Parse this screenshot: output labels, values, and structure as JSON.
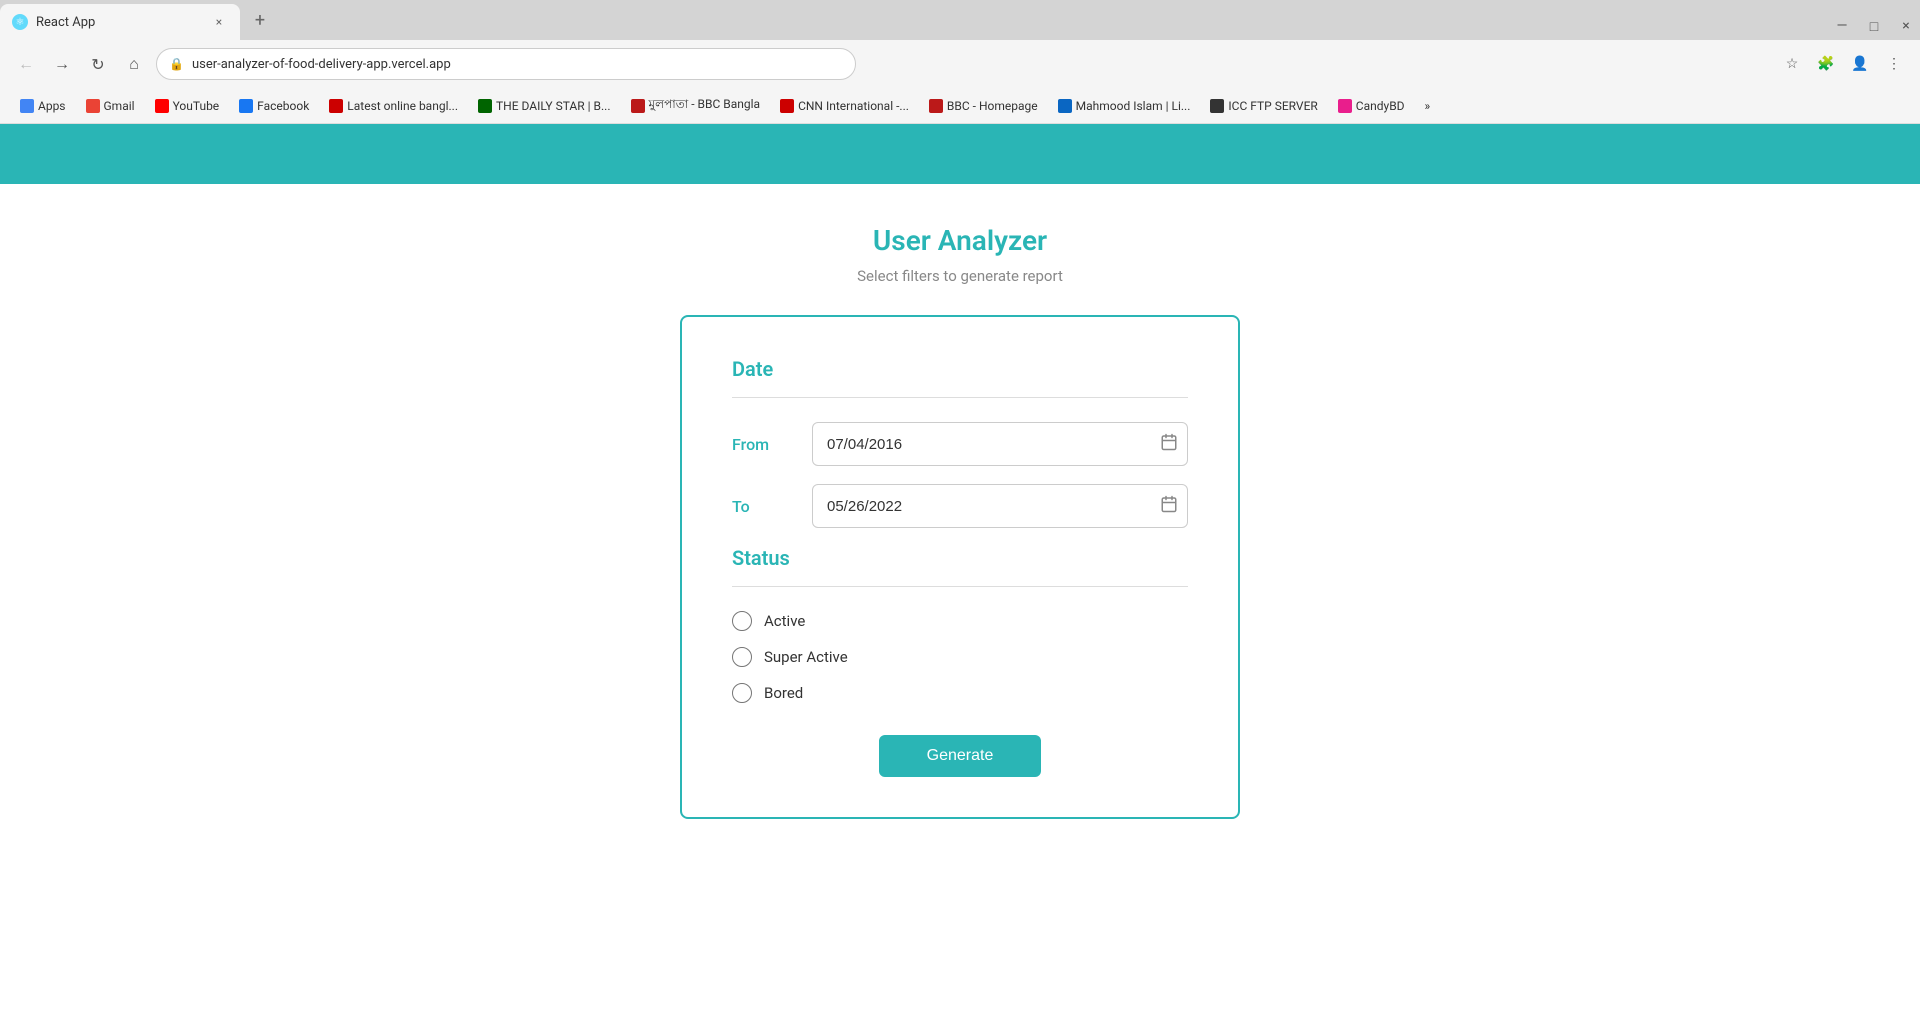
{
  "browser": {
    "tab_title": "React App",
    "tab_favicon": "⚛",
    "new_tab_icon": "+",
    "close_tab": "×",
    "address_url": "user-analyzer-of-food-delivery-app.vercel.app",
    "nav_back": "←",
    "nav_forward": "→",
    "nav_refresh": "↻",
    "nav_home": "⌂",
    "window_minimize": "—",
    "window_maximize": "□",
    "window_close": "×",
    "bookmarks": [
      {
        "label": "Apps",
        "favicon_color": "#4285f4"
      },
      {
        "label": "Gmail",
        "favicon_color": "#ea4335"
      },
      {
        "label": "YouTube",
        "favicon_color": "#ff0000"
      },
      {
        "label": "Facebook",
        "favicon_color": "#1877f2"
      },
      {
        "label": "Latest online bangl...",
        "favicon_color": "#cc0000"
      },
      {
        "label": "THE DAILY STAR | B...",
        "favicon_color": "#006400"
      },
      {
        "label": "মুলপাতা - BBC Bangla",
        "favicon_color": "#bb1919"
      },
      {
        "label": "CNN International -...",
        "favicon_color": "#cc0000"
      },
      {
        "label": "BBC - Homepage",
        "favicon_color": "#bb1919"
      },
      {
        "label": "Mahmood Islam | Li...",
        "favicon_color": "#0a66c2"
      },
      {
        "label": "ICC FTP SERVER",
        "favicon_color": "#333"
      },
      {
        "label": "CandyBD",
        "favicon_color": "#e91e8c"
      },
      {
        "label": "»",
        "favicon_color": "#666"
      }
    ]
  },
  "app": {
    "header_color": "#2ab5b5",
    "title": "User Analyzer",
    "subtitle": "Select filters to generate report",
    "form": {
      "date_section_title": "Date",
      "from_label": "From",
      "from_value": "07/04/2016",
      "to_label": "To",
      "to_value": "05/26/2022",
      "status_section_title": "Status",
      "status_options": [
        {
          "label": "Active",
          "value": "active"
        },
        {
          "label": "Super Active",
          "value": "super_active"
        },
        {
          "label": "Bored",
          "value": "bored"
        }
      ],
      "generate_button": "Generate"
    }
  }
}
